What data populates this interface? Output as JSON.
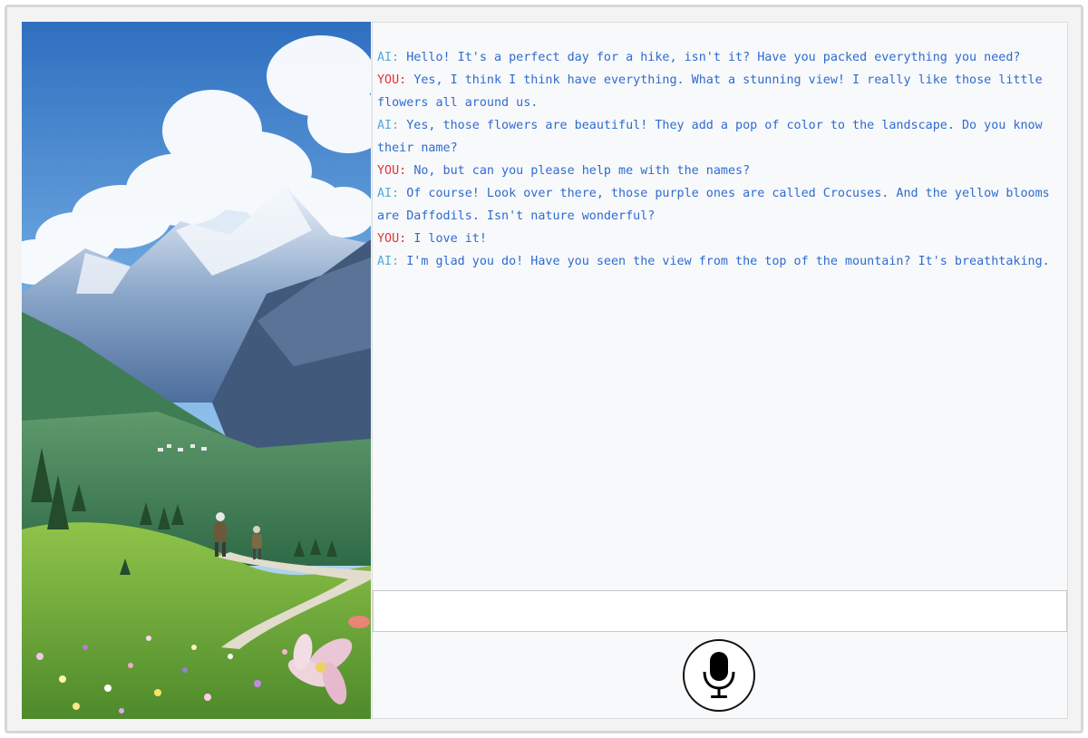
{
  "chat": {
    "messages": [
      {
        "speaker": "AI:",
        "role": "ai",
        "text": "Hello! It's a perfect day for a hike, isn't it? Have you packed everything you need?"
      },
      {
        "speaker": "YOU:",
        "role": "you",
        "text": "Yes, I think I think have everything. What a stunning view! I really like those little flowers all around us."
      },
      {
        "speaker": "AI:",
        "role": "ai",
        "text": "Yes, those flowers are beautiful! They add a pop of color to the landscape. Do you know their name?"
      },
      {
        "speaker": "YOU:",
        "role": "you",
        "text": "No, but can you please help me with the names?"
      },
      {
        "speaker": "AI:",
        "role": "ai",
        "text": "Of course! Look over there, those purple ones are called Crocuses. And the yellow blooms are Daffodils. Isn't nature wonderful?"
      },
      {
        "speaker": "YOU:",
        "role": "you",
        "text": "I love it!"
      },
      {
        "speaker": "AI:",
        "role": "ai",
        "text": "I'm glad you do! Have you seen the view from the top of the mountain? It's breathtaking."
      }
    ]
  },
  "input": {
    "value": "",
    "placeholder": ""
  },
  "mic": {
    "icon": "microphone-icon"
  },
  "colors": {
    "ai_speaker": "#56a9d8",
    "you_speaker": "#e33434",
    "message_text": "#2e6bd0"
  }
}
